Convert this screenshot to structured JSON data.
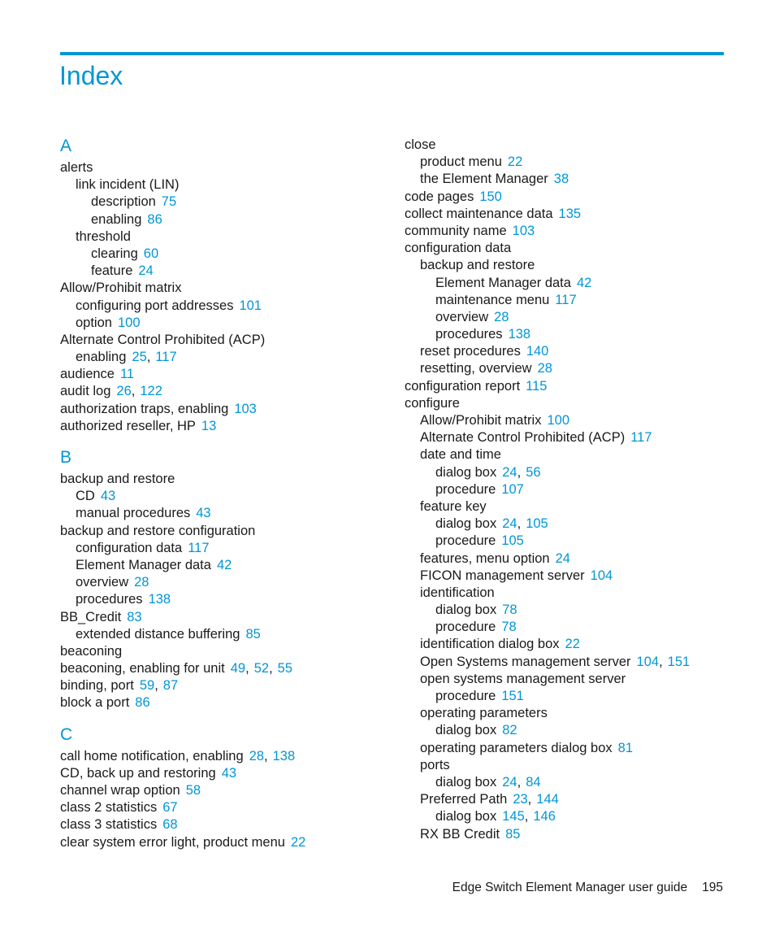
{
  "page": {
    "title": "Index",
    "accent_color": "#0096d6"
  },
  "columns": [
    {
      "groups": [
        {
          "letter": "A",
          "entries": [
            {
              "level": 1,
              "text": "alerts",
              "pages": []
            },
            {
              "level": 2,
              "text": "link incident (LIN)",
              "pages": []
            },
            {
              "level": 3,
              "text": "description",
              "pages": [
                "75"
              ]
            },
            {
              "level": 3,
              "text": "enabling",
              "pages": [
                "86"
              ]
            },
            {
              "level": 2,
              "text": "threshold",
              "pages": []
            },
            {
              "level": 3,
              "text": "clearing",
              "pages": [
                "60"
              ]
            },
            {
              "level": 3,
              "text": "feature",
              "pages": [
                "24"
              ]
            },
            {
              "level": 1,
              "text": "Allow/Prohibit matrix",
              "pages": []
            },
            {
              "level": 2,
              "text": "configuring port addresses",
              "pages": [
                "101"
              ]
            },
            {
              "level": 2,
              "text": "option",
              "pages": [
                "100"
              ]
            },
            {
              "level": 1,
              "text": "Alternate Control Prohibited (ACP)",
              "pages": []
            },
            {
              "level": 2,
              "text": "enabling",
              "pages": [
                "25",
                "117"
              ]
            },
            {
              "level": 1,
              "text": "audience",
              "pages": [
                "11"
              ]
            },
            {
              "level": 1,
              "text": "audit log",
              "pages": [
                "26",
                "122"
              ]
            },
            {
              "level": 1,
              "text": "authorization traps, enabling",
              "pages": [
                "103"
              ]
            },
            {
              "level": 1,
              "text": "authorized reseller, HP",
              "pages": [
                "13"
              ]
            }
          ]
        },
        {
          "letter": "B",
          "entries": [
            {
              "level": 1,
              "text": "backup and restore",
              "pages": []
            },
            {
              "level": 2,
              "text": "CD",
              "pages": [
                "43"
              ]
            },
            {
              "level": 2,
              "text": "manual procedures",
              "pages": [
                "43"
              ]
            },
            {
              "level": 1,
              "text": "backup and restore configuration",
              "pages": []
            },
            {
              "level": 2,
              "text": "configuration data",
              "pages": [
                "117"
              ]
            },
            {
              "level": 2,
              "text": "Element Manager data",
              "pages": [
                "42"
              ]
            },
            {
              "level": 2,
              "text": "overview",
              "pages": [
                "28"
              ]
            },
            {
              "level": 2,
              "text": "procedures",
              "pages": [
                "138"
              ]
            },
            {
              "level": 1,
              "text": "BB_Credit",
              "pages": [
                "83"
              ]
            },
            {
              "level": 2,
              "text": "extended distance buffering",
              "pages": [
                "85"
              ]
            },
            {
              "level": 1,
              "text": "beaconing",
              "pages": []
            },
            {
              "level": 1,
              "text": "beaconing, enabling for unit",
              "pages": [
                "49",
                "52",
                "55"
              ]
            },
            {
              "level": 1,
              "text": "binding, port",
              "pages": [
                "59",
                "87"
              ]
            },
            {
              "level": 1,
              "text": "block a port",
              "pages": [
                "86"
              ]
            }
          ]
        },
        {
          "letter": "C",
          "entries": [
            {
              "level": 1,
              "text": "call home notification, enabling",
              "pages": [
                "28",
                "138"
              ]
            },
            {
              "level": 1,
              "text": "CD, back up and restoring",
              "pages": [
                "43"
              ]
            },
            {
              "level": 1,
              "text": "channel wrap option",
              "pages": [
                "58"
              ]
            },
            {
              "level": 1,
              "text": "class 2 statistics",
              "pages": [
                "67"
              ]
            },
            {
              "level": 1,
              "text": "class 3 statistics",
              "pages": [
                "68"
              ]
            },
            {
              "level": 1,
              "text": "clear system error light, product menu",
              "pages": [
                "22"
              ]
            }
          ]
        }
      ]
    },
    {
      "groups": [
        {
          "letter": "",
          "entries": [
            {
              "level": 1,
              "text": "close",
              "pages": []
            },
            {
              "level": 2,
              "text": "product menu",
              "pages": [
                "22"
              ]
            },
            {
              "level": 2,
              "text": "the Element Manager",
              "pages": [
                "38"
              ]
            },
            {
              "level": 1,
              "text": "code pages",
              "pages": [
                "150"
              ]
            },
            {
              "level": 1,
              "text": "collect maintenance data",
              "pages": [
                "135"
              ]
            },
            {
              "level": 1,
              "text": "community name",
              "pages": [
                "103"
              ]
            },
            {
              "level": 1,
              "text": "configuration data",
              "pages": []
            },
            {
              "level": 2,
              "text": "backup and restore",
              "pages": []
            },
            {
              "level": 3,
              "text": "Element Manager data",
              "pages": [
                "42"
              ]
            },
            {
              "level": 3,
              "text": "maintenance menu",
              "pages": [
                "117"
              ]
            },
            {
              "level": 3,
              "text": "overview",
              "pages": [
                "28"
              ]
            },
            {
              "level": 3,
              "text": "procedures",
              "pages": [
                "138"
              ]
            },
            {
              "level": 2,
              "text": "reset procedures",
              "pages": [
                "140"
              ]
            },
            {
              "level": 2,
              "text": "resetting, overview",
              "pages": [
                "28"
              ]
            },
            {
              "level": 1,
              "text": "configuration report",
              "pages": [
                "115"
              ]
            },
            {
              "level": 1,
              "text": "configure",
              "pages": []
            },
            {
              "level": 2,
              "text": "Allow/Prohibit matrix",
              "pages": [
                "100"
              ]
            },
            {
              "level": 2,
              "text": "Alternate Control Prohibited (ACP)",
              "pages": [
                "117"
              ]
            },
            {
              "level": 2,
              "text": "date and time",
              "pages": []
            },
            {
              "level": 3,
              "text": "dialog box",
              "pages": [
                "24",
                "56"
              ]
            },
            {
              "level": 3,
              "text": "procedure",
              "pages": [
                "107"
              ]
            },
            {
              "level": 2,
              "text": "feature key",
              "pages": []
            },
            {
              "level": 3,
              "text": "dialog box",
              "pages": [
                "24",
                "105"
              ]
            },
            {
              "level": 3,
              "text": "procedure",
              "pages": [
                "105"
              ]
            },
            {
              "level": 2,
              "text": "features, menu option",
              "pages": [
                "24"
              ]
            },
            {
              "level": 2,
              "text": "FICON management server",
              "pages": [
                "104"
              ]
            },
            {
              "level": 2,
              "text": "identification",
              "pages": []
            },
            {
              "level": 3,
              "text": "dialog box",
              "pages": [
                "78"
              ]
            },
            {
              "level": 3,
              "text": "procedure",
              "pages": [
                "78"
              ]
            },
            {
              "level": 2,
              "text": "identification dialog box",
              "pages": [
                "22"
              ]
            },
            {
              "level": 2,
              "text": "Open Systems management server",
              "pages": [
                "104",
                "151"
              ]
            },
            {
              "level": 2,
              "text": "open systems management server",
              "pages": []
            },
            {
              "level": 3,
              "text": "procedure",
              "pages": [
                "151"
              ]
            },
            {
              "level": 2,
              "text": "operating parameters",
              "pages": []
            },
            {
              "level": 3,
              "text": "dialog box",
              "pages": [
                "82"
              ]
            },
            {
              "level": 2,
              "text": "operating parameters dialog box",
              "pages": [
                "81"
              ]
            },
            {
              "level": 2,
              "text": "ports",
              "pages": []
            },
            {
              "level": 3,
              "text": "dialog box",
              "pages": [
                "24",
                "84"
              ]
            },
            {
              "level": 2,
              "text": "Preferred Path",
              "pages": [
                "23",
                "144"
              ]
            },
            {
              "level": 3,
              "text": "dialog box",
              "pages": [
                "145",
                "146"
              ]
            },
            {
              "level": 2,
              "text": "RX BB Credit",
              "pages": [
                "85"
              ]
            }
          ]
        }
      ]
    }
  ],
  "footer": {
    "guide_title": "Edge Switch Element Manager user guide",
    "page_number": "195"
  }
}
